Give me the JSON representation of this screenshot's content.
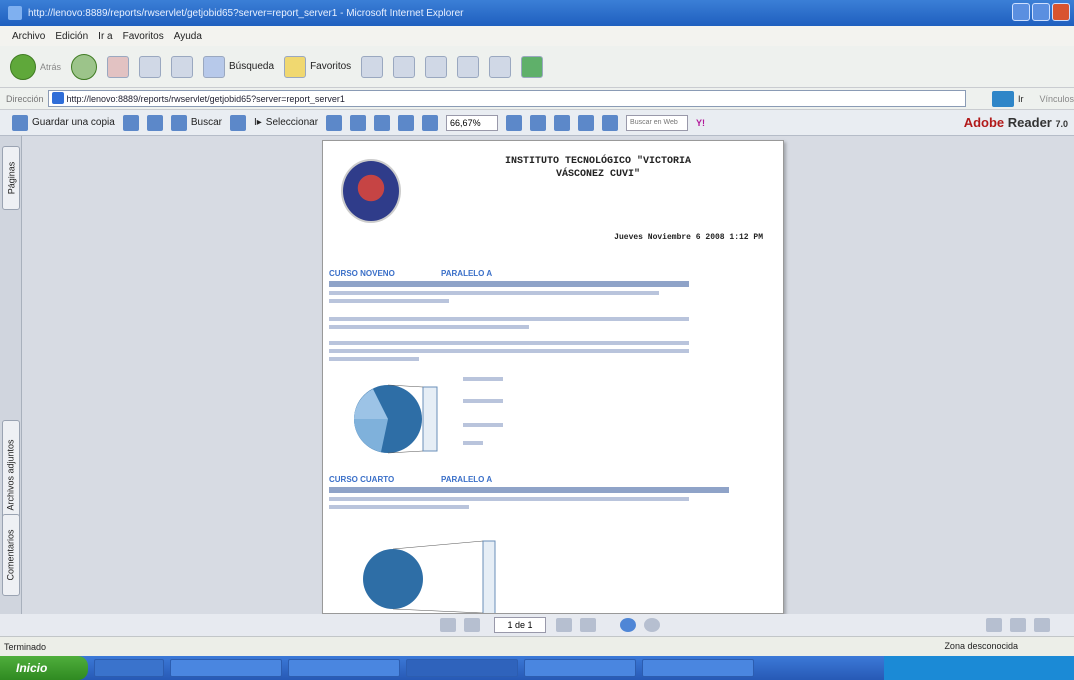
{
  "window": {
    "title": "http://lenovo:8889/reports/rwservlet/getjobid65?server=report_server1 - Microsoft Internet Explorer"
  },
  "menu": [
    "Archivo",
    "Edición",
    "Ir a",
    "Favoritos",
    "Ayuda"
  ],
  "toolbar": {
    "back": "Atrás",
    "search": "Búsqueda",
    "favorites": "Favoritos"
  },
  "address": {
    "label": "Dirección",
    "url": "http://lenovo:8889/reports/rwservlet/getjobid65?server=report_server1",
    "go": "Ir",
    "links": "Vínculos"
  },
  "reader": {
    "save": "Guardar una copia",
    "find": "Buscar",
    "select": "Seleccionar",
    "zoom": "66,67%",
    "find_field_placeholder": "Buscar en Web",
    "brand_a": "Adobe",
    "brand_b": "Reader",
    "brand_version": "7.0"
  },
  "sidetabs": {
    "pages": "Páginas",
    "attachments": "Archivos adjuntos",
    "comments": "Comentarios"
  },
  "document": {
    "title_line1": "INSTITUTO TECNOLÓGICO \"VICTORIA",
    "title_line2": "VÁSCONEZ CUVI\"",
    "date": "Jueves Noviembre 6 2008 1:12 PM",
    "section1": {
      "course": "CURSO NOVENO",
      "parallel": "PARALELO A"
    },
    "section2": {
      "course": "CURSO CUARTO",
      "parallel": "PARALELO A"
    }
  },
  "pagenav": {
    "page_value": "1 de 1"
  },
  "status": {
    "left": "Terminado",
    "zone": "Zona desconocida"
  },
  "taskbar": {
    "start": "Inicio"
  }
}
